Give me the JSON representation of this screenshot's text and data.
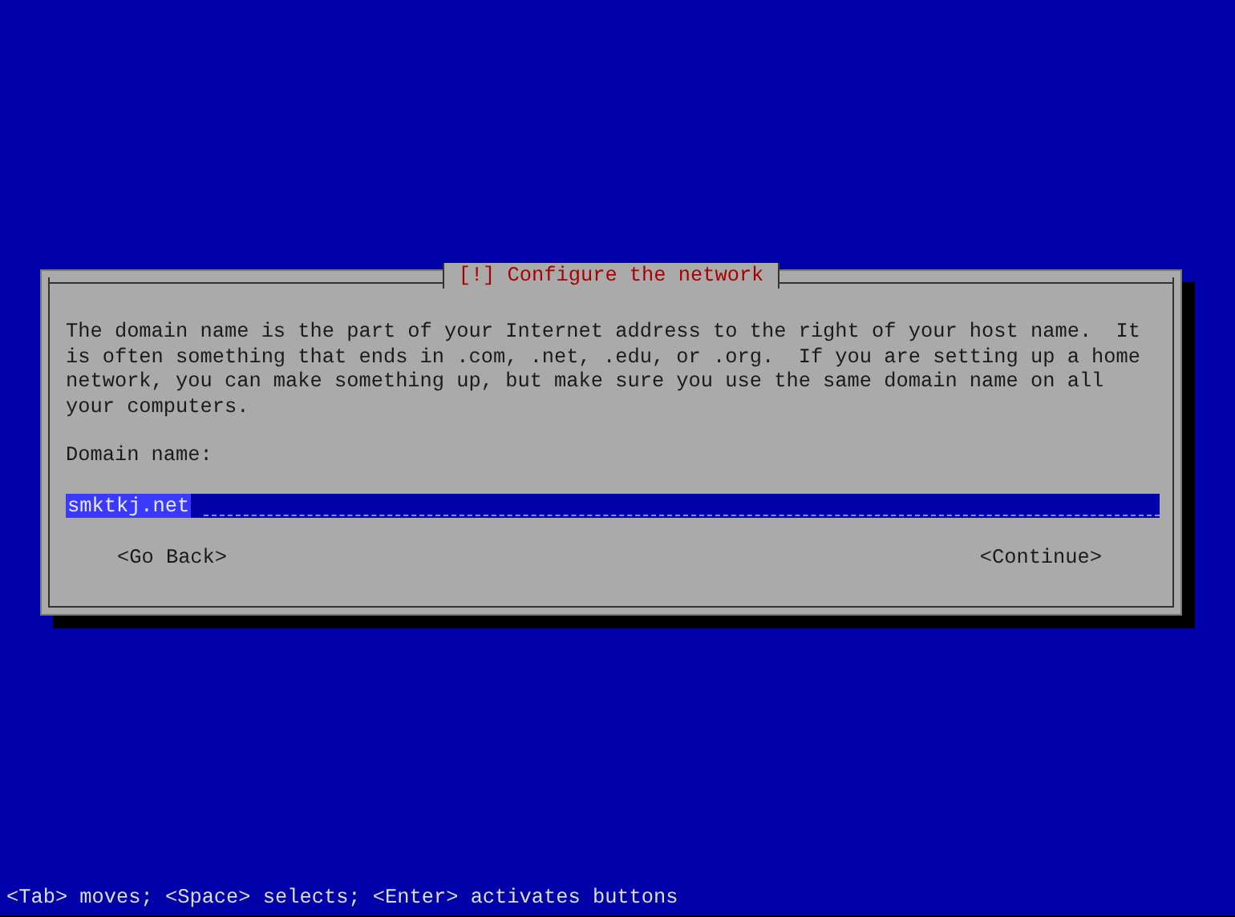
{
  "dialog": {
    "title": "[!] Configure the network",
    "description": "The domain name is the part of your Internet address to the right of your host name.  It is often something that ends in .com, .net, .edu, or .org.  If you are setting up a home network, you can make something up, but make sure you use the same domain name on all your computers.",
    "field_label": "Domain name:",
    "field": {
      "value": "smktkj.net"
    },
    "buttons": [
      {
        "label": "<Go Back>",
        "selected": false
      },
      {
        "label": "<Continue>",
        "selected": false
      }
    ]
  },
  "status_bar": "<Tab> moves; <Space> selects; <Enter> activates buttons"
}
